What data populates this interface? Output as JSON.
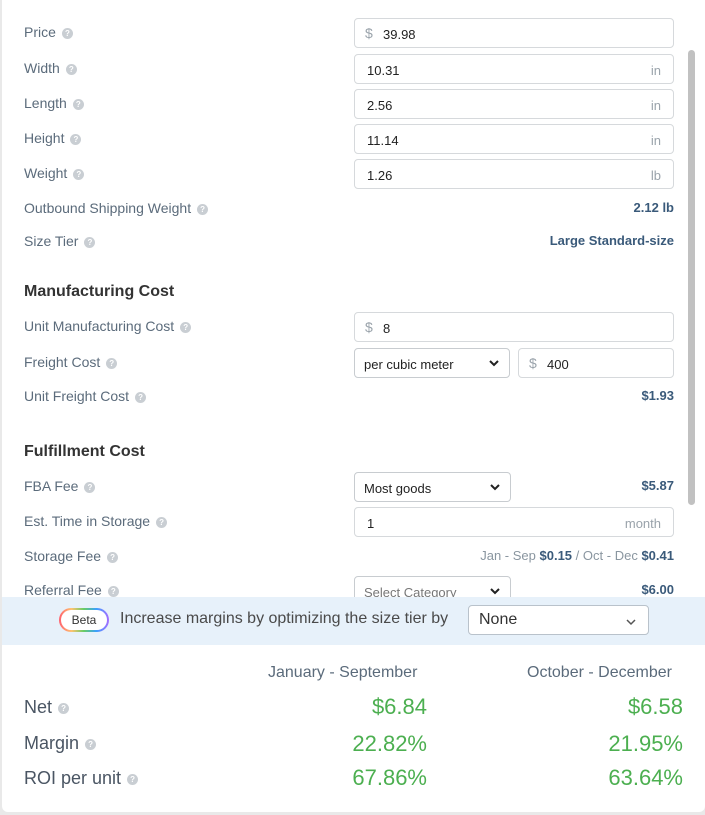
{
  "fields": {
    "price": {
      "label": "Price",
      "prefix": "$",
      "value": "39.98"
    },
    "width": {
      "label": "Width",
      "value": "10.31",
      "unit": "in"
    },
    "length": {
      "label": "Length",
      "value": "2.56",
      "unit": "in"
    },
    "height": {
      "label": "Height",
      "value": "11.14",
      "unit": "in"
    },
    "weight": {
      "label": "Weight",
      "value": "1.26",
      "unit": "lb"
    },
    "outbound": {
      "label": "Outbound Shipping Weight",
      "value": "2.12 lb"
    },
    "size_tier": {
      "label": "Size Tier",
      "value": "Large Standard-size"
    }
  },
  "manufacturing": {
    "title": "Manufacturing Cost",
    "unit_cost": {
      "label": "Unit Manufacturing Cost",
      "prefix": "$",
      "value": "8"
    },
    "freight": {
      "label": "Freight Cost",
      "select": "per cubic meter",
      "prefix": "$",
      "value": "400"
    },
    "unit_freight": {
      "label": "Unit Freight Cost",
      "value": "$1.93"
    }
  },
  "fulfillment": {
    "title": "Fulfillment Cost",
    "fba": {
      "label": "FBA Fee",
      "select": "Most goods",
      "value": "$5.87"
    },
    "storage_time": {
      "label": "Est. Time in Storage",
      "value": "1",
      "unit": "month"
    },
    "storage_fee": {
      "label": "Storage Fee",
      "p1": "Jan - Sep",
      "v1": "$0.15",
      "sep": "/",
      "p2": "Oct - Dec",
      "v2": "$0.41"
    },
    "referral": {
      "label": "Referral Fee",
      "select": "Select Category",
      "value": "$6.00"
    }
  },
  "beta": {
    "badge": "Beta",
    "text": "Increase margins by optimizing the size tier by",
    "select": "None"
  },
  "results": {
    "col1": "January - September",
    "col2": "October - December",
    "rows": [
      {
        "label": "Net",
        "v1": "$6.84",
        "v2": "$6.58"
      },
      {
        "label": "Margin",
        "v1": "22.82%",
        "v2": "21.95%"
      },
      {
        "label": "ROI per unit",
        "v1": "67.86%",
        "v2": "63.64%"
      }
    ]
  },
  "colors": {
    "accent_green": "#4caf50",
    "beta_bg": "#e7f1fa",
    "value_blue": "#3a5a7a"
  }
}
